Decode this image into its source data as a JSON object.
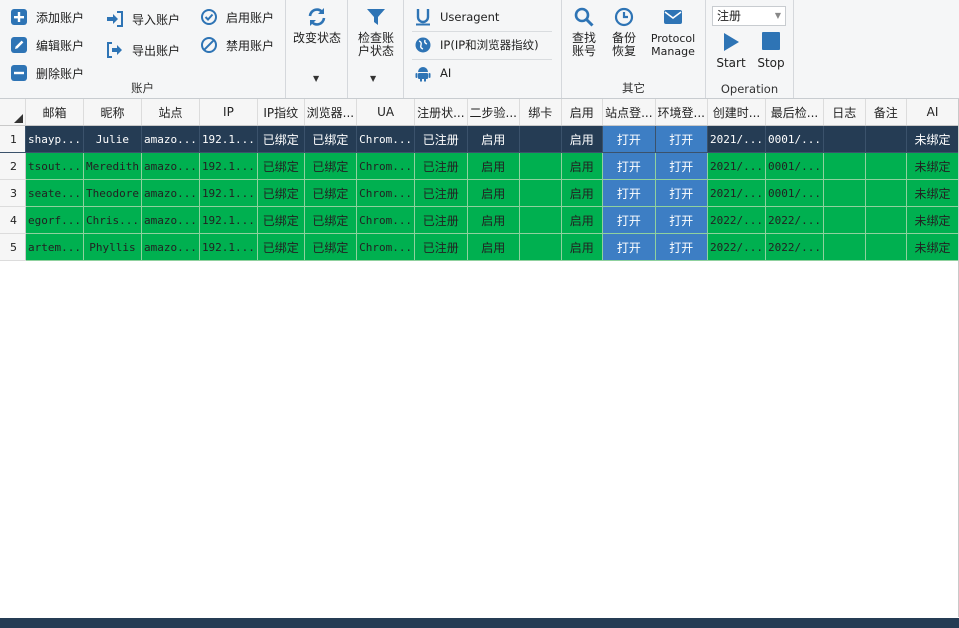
{
  "ribbon": {
    "account_group": {
      "label": "账户",
      "add": "添加账户",
      "edit": "编辑账户",
      "delete": "删除账户",
      "import": "导入账户",
      "export": "导出账户",
      "enable": "启用账户",
      "disable": "禁用账户"
    },
    "change_status": "改变状态",
    "check_status": "检查账户状态",
    "settings_group": {
      "useragent": "Useragent",
      "ip": "IP(IP和浏览器指纹)",
      "ai": "AI"
    },
    "other_group": {
      "label": "其它",
      "find": "查找账号",
      "backup": "备份恢复",
      "protocol": "Protocol Manage"
    },
    "operation_group": {
      "label": "Operation",
      "combo_value": "注册",
      "start": "Start",
      "stop": "Stop"
    }
  },
  "grid": {
    "columns": [
      "邮箱",
      "昵称",
      "站点",
      "IP",
      "IP指纹",
      "浏览器...",
      "UA",
      "注册状...",
      "二步验...",
      "绑卡",
      "启用",
      "站点登...",
      "环境登...",
      "创建时...",
      "最后检...",
      "日志",
      "备注",
      "AI"
    ],
    "rows": [
      {
        "num": "1",
        "email": "shayp...",
        "nick": "Julie",
        "site": "amazo...",
        "ip": "192.1...",
        "ipfp": "已绑定",
        "browser": "已绑定",
        "ua": "Chrom...",
        "reg": "已注册",
        "twostep": "启用",
        "card": "",
        "enabled": "启用",
        "sitelogin": "打开",
        "envlogin": "打开",
        "created": "2021/...",
        "lastcheck": "0001/...",
        "log": "",
        "note": "",
        "ai": "未绑定"
      },
      {
        "num": "2",
        "email": "tsout...",
        "nick": "Meredith",
        "site": "amazo...",
        "ip": "192.1...",
        "ipfp": "已绑定",
        "browser": "已绑定",
        "ua": "Chrom...",
        "reg": "已注册",
        "twostep": "启用",
        "card": "",
        "enabled": "启用",
        "sitelogin": "打开",
        "envlogin": "打开",
        "created": "2021/...",
        "lastcheck": "0001/...",
        "log": "",
        "note": "",
        "ai": "未绑定"
      },
      {
        "num": "3",
        "email": "seate...",
        "nick": "Theodore",
        "site": "amazo...",
        "ip": "192.1...",
        "ipfp": "已绑定",
        "browser": "已绑定",
        "ua": "Chrom...",
        "reg": "已注册",
        "twostep": "启用",
        "card": "",
        "enabled": "启用",
        "sitelogin": "打开",
        "envlogin": "打开",
        "created": "2021/...",
        "lastcheck": "0001/...",
        "log": "",
        "note": "",
        "ai": "未绑定"
      },
      {
        "num": "4",
        "email": "egorf...",
        "nick": "Chris...",
        "site": "amazo...",
        "ip": "192.1...",
        "ipfp": "已绑定",
        "browser": "已绑定",
        "ua": "Chrom...",
        "reg": "已注册",
        "twostep": "启用",
        "card": "",
        "enabled": "启用",
        "sitelogin": "打开",
        "envlogin": "打开",
        "created": "2022/...",
        "lastcheck": "2022/...",
        "log": "",
        "note": "",
        "ai": "未绑定"
      },
      {
        "num": "5",
        "email": "artem...",
        "nick": "Phyllis",
        "site": "amazo...",
        "ip": "192.1...",
        "ipfp": "已绑定",
        "browser": "已绑定",
        "ua": "Chrom...",
        "reg": "已注册",
        "twostep": "启用",
        "card": "",
        "enabled": "启用",
        "sitelogin": "打开",
        "envlogin": "打开",
        "created": "2022/...",
        "lastcheck": "2022/...",
        "log": "",
        "note": "",
        "ai": "未绑定"
      }
    ]
  },
  "colors": {
    "row_green": "#00b050",
    "row_selected": "#253c54",
    "cell_blue": "#3d7ec4",
    "icon_blue": "#2e74b5"
  },
  "icons": [
    "plus-icon",
    "pencil-icon",
    "minus-icon",
    "sign-in-icon",
    "sign-out-icon",
    "check-circle-icon",
    "ban-icon",
    "refresh-icon",
    "filter-icon",
    "underline-icon",
    "globe-icon",
    "android-icon",
    "search-icon",
    "clock-icon",
    "envelope-icon",
    "play-icon",
    "stop-icon"
  ]
}
